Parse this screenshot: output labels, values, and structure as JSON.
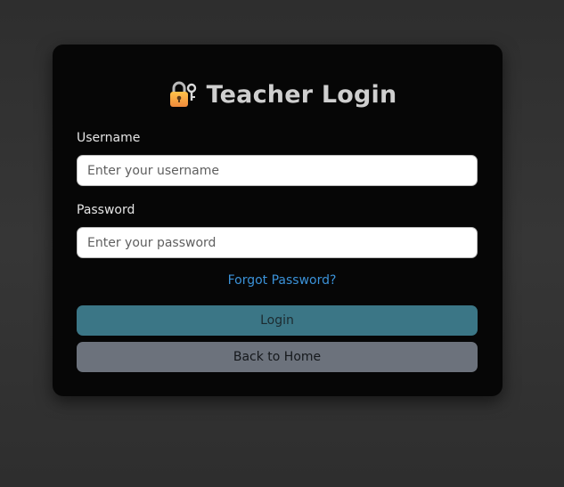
{
  "login_form": {
    "title": "Teacher Login",
    "title_icon": "lock-with-key-icon",
    "username_label": "Username",
    "username_value": "",
    "username_placeholder": "Enter your username",
    "password_label": "Password",
    "password_value": "",
    "password_placeholder": "Enter your password",
    "forgot_password_link": "Forgot Password?",
    "login_button": "Login",
    "back_home_button": "Back to Home"
  },
  "colors": {
    "background": "#333333",
    "card": "#060606",
    "link": "#3b92d8",
    "login_button": "#3b7686",
    "back_button": "#6c727c"
  }
}
